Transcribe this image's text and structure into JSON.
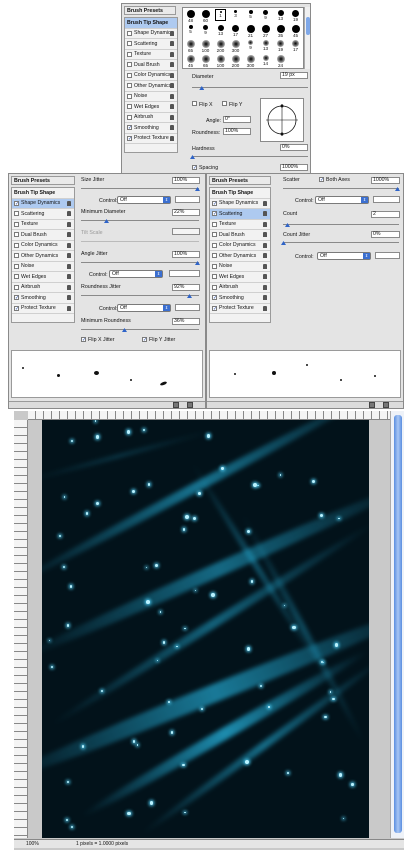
{
  "top_panel": {
    "header": "Brush Presets",
    "items": [
      {
        "label": "Brush Tip Shape",
        "checkbox": false,
        "checked": false,
        "selected": true,
        "lock": false
      },
      {
        "label": "Shape Dynamics",
        "checkbox": true,
        "checked": false,
        "selected": false,
        "lock": true
      },
      {
        "label": "Scattering",
        "checkbox": true,
        "checked": false,
        "selected": false,
        "lock": true
      },
      {
        "label": "Texture",
        "checkbox": true,
        "checked": false,
        "selected": false,
        "lock": true
      },
      {
        "label": "Dual Brush",
        "checkbox": true,
        "checked": false,
        "selected": false,
        "lock": true
      },
      {
        "label": "Color Dynamics",
        "checkbox": true,
        "checked": false,
        "selected": false,
        "lock": true
      },
      {
        "label": "Other Dynamics",
        "checkbox": true,
        "checked": false,
        "selected": false,
        "lock": true
      },
      {
        "label": "Noise",
        "checkbox": true,
        "checked": false,
        "selected": false,
        "lock": true
      },
      {
        "label": "Wet Edges",
        "checkbox": true,
        "checked": false,
        "selected": false,
        "lock": true
      },
      {
        "label": "Airbrush",
        "checkbox": true,
        "checked": false,
        "selected": false,
        "lock": true
      },
      {
        "label": "Smoothing",
        "checkbox": true,
        "checked": true,
        "selected": false,
        "lock": true
      },
      {
        "label": "Protect Texture",
        "checkbox": true,
        "checked": true,
        "selected": false,
        "lock": true
      }
    ],
    "brush_sizes": [
      "48",
      "60",
      "1",
      "3",
      "5",
      "9",
      "13",
      "19",
      "5",
      "9",
      "13",
      "17",
      "21",
      "27",
      "35",
      "45",
      "65",
      "100",
      "200",
      "300",
      "9",
      "13",
      "19",
      "17",
      "45",
      "65",
      "100",
      "200",
      "300",
      "14",
      "24"
    ],
    "diameter_label": "Diameter",
    "diameter_value": "19 px",
    "diameter_level": 0.08,
    "flip_x": "Flip X",
    "flip_y": "Flip Y",
    "angle_label": "Angle:",
    "angle_value": "0°",
    "roundness_label": "Roundness:",
    "roundness_value": "100%",
    "hardness_label": "Hardness",
    "hardness_value": "0%",
    "spacing_label": "Spacing",
    "spacing_checked": true,
    "spacing_value": "1000%"
  },
  "left_panel": {
    "header": "Brush Presets",
    "items": [
      {
        "label": "Brush Tip Shape",
        "checkbox": false,
        "checked": false,
        "selected": false,
        "lock": false
      },
      {
        "label": "Shape Dynamics",
        "checkbox": true,
        "checked": true,
        "selected": true,
        "lock": true
      },
      {
        "label": "Scattering",
        "checkbox": true,
        "checked": false,
        "selected": false,
        "lock": true
      },
      {
        "label": "Texture",
        "checkbox": true,
        "checked": false,
        "selected": false,
        "lock": true
      },
      {
        "label": "Dual Brush",
        "checkbox": true,
        "checked": false,
        "selected": false,
        "lock": true
      },
      {
        "label": "Color Dynamics",
        "checkbox": true,
        "checked": false,
        "selected": false,
        "lock": true
      },
      {
        "label": "Other Dynamics",
        "checkbox": true,
        "checked": false,
        "selected": false,
        "lock": true
      },
      {
        "label": "Noise",
        "checkbox": true,
        "checked": false,
        "selected": false,
        "lock": true
      },
      {
        "label": "Wet Edges",
        "checkbox": true,
        "checked": false,
        "selected": false,
        "lock": true
      },
      {
        "label": "Airbrush",
        "checkbox": true,
        "checked": false,
        "selected": false,
        "lock": true
      },
      {
        "label": "Smoothing",
        "checkbox": true,
        "checked": true,
        "selected": false,
        "lock": true
      },
      {
        "label": "Protect Texture",
        "checkbox": true,
        "checked": true,
        "selected": false,
        "lock": true
      }
    ],
    "size_jitter_label": "Size Jitter",
    "size_jitter_value": "100%",
    "control_label": "Control:",
    "control_value": "Off",
    "min_diameter_label": "Minimum Diameter",
    "min_diameter_value": "22%",
    "tilt_scale_label": "Tilt Scale",
    "angle_jitter_label": "Angle Jitter",
    "angle_jitter_value": "100%",
    "control2_label": "Control:",
    "control2_value": "Off",
    "roundness_jitter_label": "Roundness Jitter",
    "roundness_jitter_value": "92%",
    "control3_label": "Control:",
    "control3_value": "Off",
    "min_roundness_label": "Minimum Roundness",
    "min_roundness_value": "36%",
    "flip_x_jitter": "Flip X Jitter",
    "flip_y_jitter": "Flip Y Jitter"
  },
  "right_panel": {
    "header": "Brush Presets",
    "items": [
      {
        "label": "Brush Tip Shape",
        "checkbox": false,
        "checked": false,
        "selected": false,
        "lock": false
      },
      {
        "label": "Shape Dynamics",
        "checkbox": true,
        "checked": true,
        "selected": false,
        "lock": true
      },
      {
        "label": "Scattering",
        "checkbox": true,
        "checked": true,
        "selected": true,
        "lock": true
      },
      {
        "label": "Texture",
        "checkbox": true,
        "checked": false,
        "selected": false,
        "lock": true
      },
      {
        "label": "Dual Brush",
        "checkbox": true,
        "checked": false,
        "selected": false,
        "lock": true
      },
      {
        "label": "Color Dynamics",
        "checkbox": true,
        "checked": false,
        "selected": false,
        "lock": true
      },
      {
        "label": "Other Dynamics",
        "checkbox": true,
        "checked": false,
        "selected": false,
        "lock": true
      },
      {
        "label": "Noise",
        "checkbox": true,
        "checked": false,
        "selected": false,
        "lock": true
      },
      {
        "label": "Wet Edges",
        "checkbox": true,
        "checked": false,
        "selected": false,
        "lock": true
      },
      {
        "label": "Airbrush",
        "checkbox": true,
        "checked": false,
        "selected": false,
        "lock": true
      },
      {
        "label": "Smoothing",
        "checkbox": true,
        "checked": true,
        "selected": false,
        "lock": true
      },
      {
        "label": "Protect Texture",
        "checkbox": true,
        "checked": true,
        "selected": false,
        "lock": true
      }
    ],
    "scatter_label": "Scatter",
    "both_axes_label": "Both Axes",
    "scatter_value": "1000%",
    "control_label": "Control:",
    "control_value": "Off",
    "count_label": "Count",
    "count_value": "2",
    "count_jitter_label": "Count Jitter",
    "count_jitter_value": "0%",
    "control2_label": "Control:",
    "control2_value": "Off"
  },
  "status_bar": {
    "zoom": "100%",
    "info": "1 pixels = 1.0000 pixels"
  },
  "colors": {
    "selection": "#aecaf0",
    "accent": "#2f64c8",
    "canvas_bg": "#02121a",
    "glow": "#54d6ff"
  }
}
